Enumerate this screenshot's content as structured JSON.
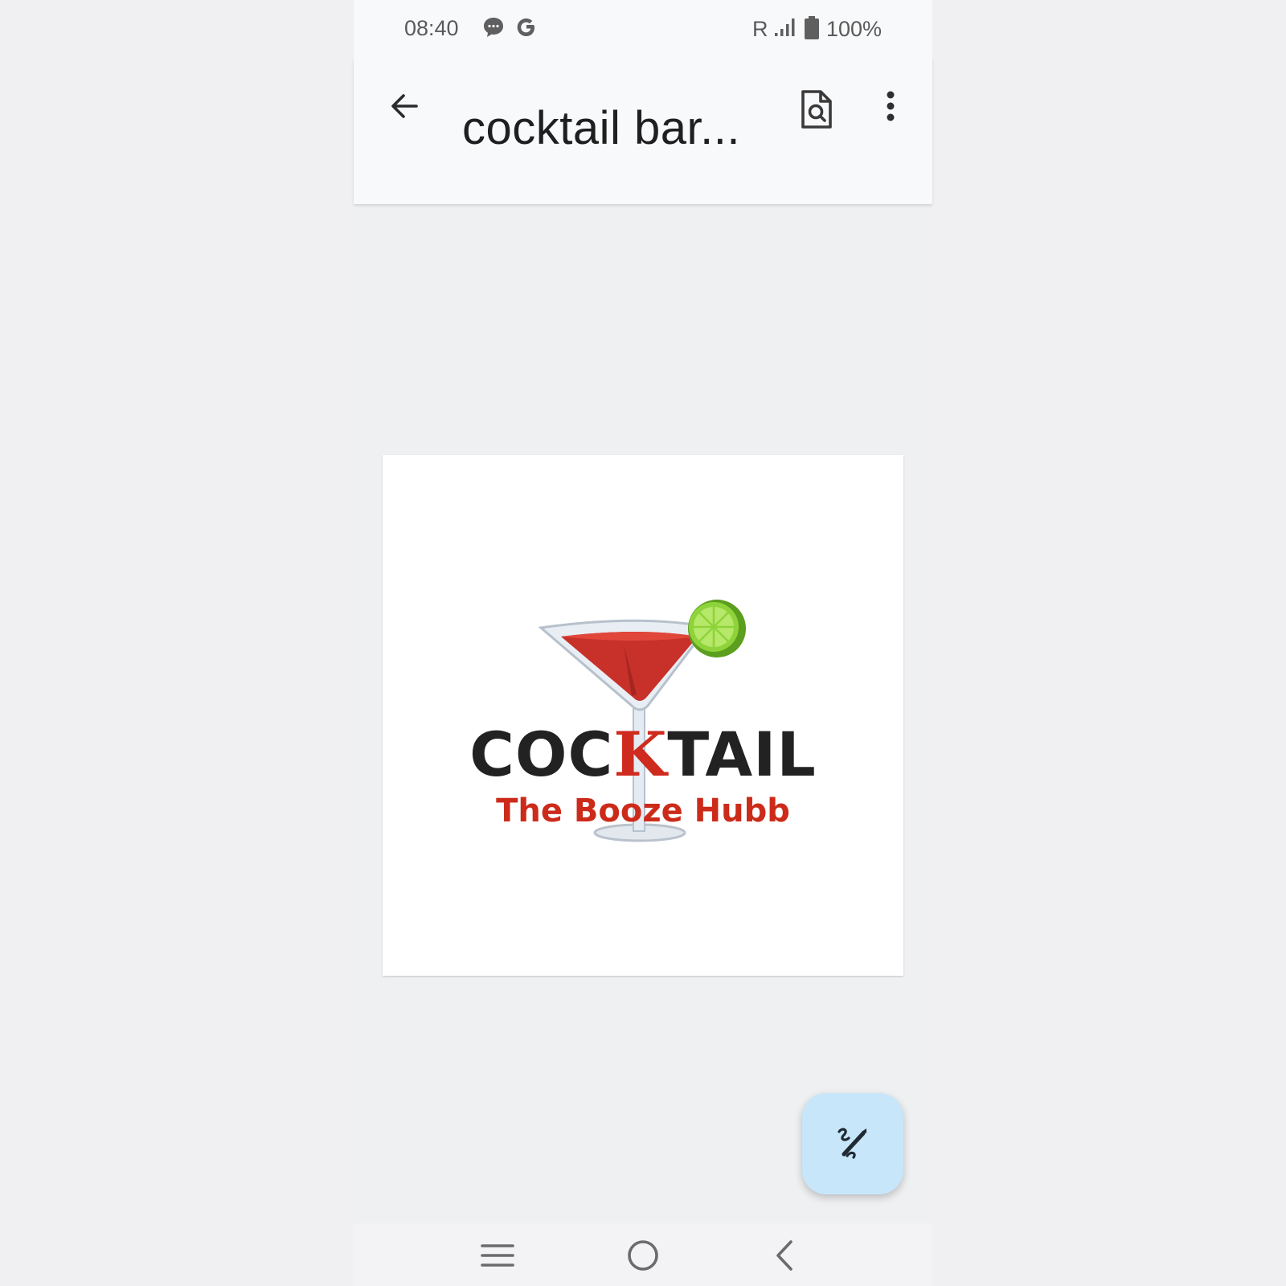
{
  "status_bar": {
    "time": "08:40",
    "roaming": "R",
    "battery": "100%",
    "icons": [
      "messages-icon",
      "google-icon",
      "signal-icon",
      "battery-icon"
    ]
  },
  "app_bar": {
    "title": "cocktail bar...",
    "icons": [
      "back-arrow-icon",
      "find-in-document-icon",
      "more-vert-icon"
    ]
  },
  "document": {
    "logo_word_prefix": "COC",
    "logo_word_accent": "K",
    "logo_word_suffix": "TAIL",
    "logo_tagline": "The Booze Hubb"
  },
  "fab": {
    "icon": "draw-pen-icon"
  },
  "nav_bar": {
    "icons": [
      "recents-icon",
      "home-icon",
      "back-icon"
    ]
  },
  "colors": {
    "fab_bg": "#c8e6fa",
    "logo_red": "#cf2a1e",
    "logo_dark": "#222222",
    "lime": "#7dc42b"
  }
}
